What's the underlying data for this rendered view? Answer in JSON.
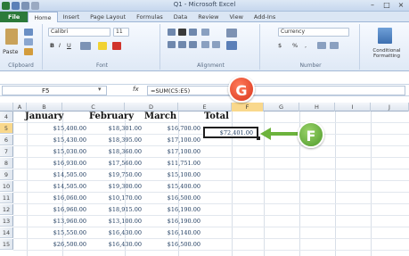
{
  "window": {
    "title": "Q1 - Microsoft Excel",
    "minimize": "–",
    "maximize": "□",
    "close": "×"
  },
  "tabs": [
    {
      "label": "File"
    },
    {
      "label": "Home"
    },
    {
      "label": "Insert"
    },
    {
      "label": "Page Layout"
    },
    {
      "label": "Formulas"
    },
    {
      "label": "Data"
    },
    {
      "label": "Review"
    },
    {
      "label": "View"
    },
    {
      "label": "Add-Ins"
    }
  ],
  "ribbon": {
    "clipboard": {
      "paste": "Paste",
      "label": "Clipboard"
    },
    "font": {
      "name": "Calibri",
      "size": "11",
      "bold": "B",
      "italic": "I",
      "underline": "U",
      "label": "Font"
    },
    "alignment": {
      "label": "Alignment"
    },
    "number": {
      "format": "Currency",
      "currency": "$",
      "percent": "%",
      "comma": ",",
      "label": "Number"
    },
    "styles": {
      "conditional": "Conditional Formatting"
    }
  },
  "formula_bar": {
    "name_box": "F5",
    "fx": "fx",
    "formula": "=SUM(C5:E5)"
  },
  "columns": [
    "A",
    "B",
    "C",
    "D",
    "E",
    "F",
    "G",
    "H",
    "I",
    "J"
  ],
  "selected_column": "F",
  "rows": [
    "4",
    "5",
    "6",
    "7",
    "8",
    "9",
    "10",
    "11",
    "12",
    "13",
    "14",
    "15"
  ],
  "selected_row": "5",
  "sheet": {
    "headers": {
      "c": "January",
      "d": "February",
      "e": "March",
      "f": "Total"
    },
    "data": [
      {
        "c": "$15,400.00",
        "d": "$18,301.00",
        "e": "$16,700.00"
      },
      {
        "c": "$15,430.00",
        "d": "$18,395.00",
        "e": "$17,100.00"
      },
      {
        "c": "$15,030.00",
        "d": "$18,360.00",
        "e": "$17,100.00"
      },
      {
        "c": "$16,930.00",
        "d": "$17,560.00",
        "e": "$11,751.00"
      },
      {
        "c": "$14,505.00",
        "d": "$19,750.00",
        "e": "$15,100.00"
      },
      {
        "c": "$14,505.00",
        "d": "$19,300.00",
        "e": "$15,400.00"
      },
      {
        "c": "$16,060.00",
        "d": "$10,170.00",
        "e": "$16,500.00"
      },
      {
        "c": "$16,960.00",
        "d": "$18,915.00",
        "e": "$16,190.00"
      },
      {
        "c": "$13,960.00",
        "d": "$13,100.00",
        "e": "$16,190.00"
      },
      {
        "c": "$15,550.00",
        "d": "$16,430.00",
        "e": "$16,140.00"
      },
      {
        "c": "$26,500.00",
        "d": "$16,430.00",
        "e": "$16,500.00"
      }
    ],
    "active_cell_value": "$72,401.00"
  },
  "callouts": {
    "g": "G",
    "f": "F"
  },
  "colors": {
    "file_tab": "#2c7a3a",
    "callout_red": "#d9361c",
    "callout_green": "#4e9a2a",
    "selection": "#f9d88c"
  }
}
